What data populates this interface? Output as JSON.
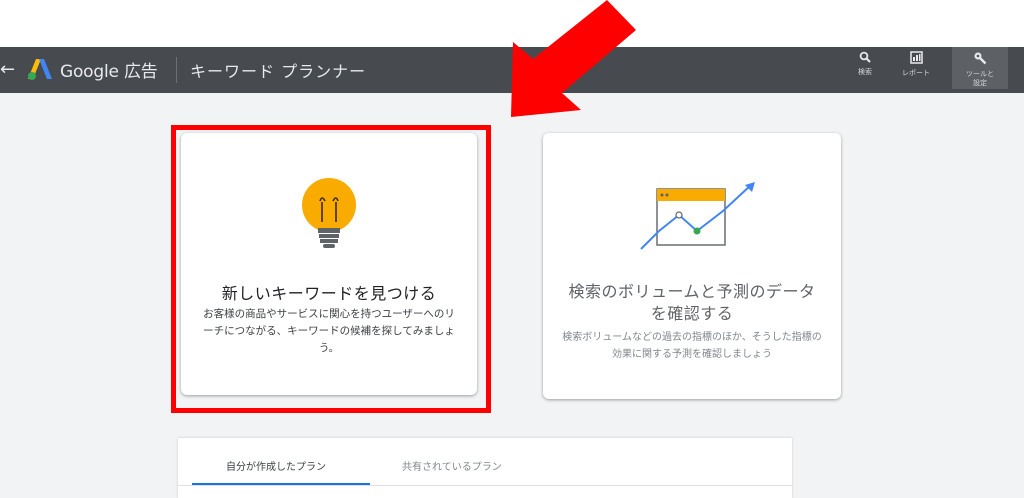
{
  "header": {
    "back": "←",
    "brand": "Google 広告",
    "page_title": "キーワード プランナー",
    "tools": [
      {
        "icon": "search-icon",
        "label": "検索"
      },
      {
        "icon": "report-icon",
        "label": "レポート"
      },
      {
        "icon": "wrench-icon",
        "label1": "ツールと",
        "label2": "設定"
      }
    ]
  },
  "cards": {
    "find": {
      "icon": "lightbulb-icon",
      "title": "新しいキーワードを見つける",
      "description": "お客様の商品やサービスに関心を持つユーザーへのリーチにつながる、キーワードの候補を探してみましょう。"
    },
    "forecast": {
      "icon": "trend-chart-icon",
      "title": "検索のボリュームと予測のデータを確認する",
      "description": "検索ボリュームなどの過去の指標のほか、そうした指標の効果に関する予測を確認しましょう"
    }
  },
  "plans": {
    "tabs": [
      "自分が作成したプラン",
      "共有されているプラン"
    ]
  },
  "colors": {
    "topbar": "#474a4e",
    "highlight": "#ff0000",
    "arrow": "#ff0000",
    "bulb": "#f9ab00",
    "accent": "#1a73e8"
  }
}
